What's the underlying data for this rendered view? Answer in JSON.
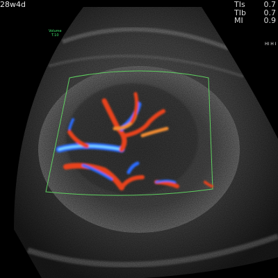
{
  "header": {
    "gestational_age": "28w4d"
  },
  "safety_indices": [
    {
      "label": "TIs",
      "value": "0.7"
    },
    {
      "label": "TIb",
      "value": "0.7"
    },
    {
      "label": "MI",
      "value": "0.9"
    }
  ],
  "volume_indicator": {
    "label": "Volume",
    "value": "T.10"
  },
  "side_label": "HI H I",
  "colors": {
    "background": "#000000",
    "roi_box": "#5fd060",
    "doppler_red": "#e8421c",
    "doppler_orange": "#f08a30",
    "doppler_blue": "#2b6cff",
    "doppler_cyan": "#7fd8ff"
  }
}
